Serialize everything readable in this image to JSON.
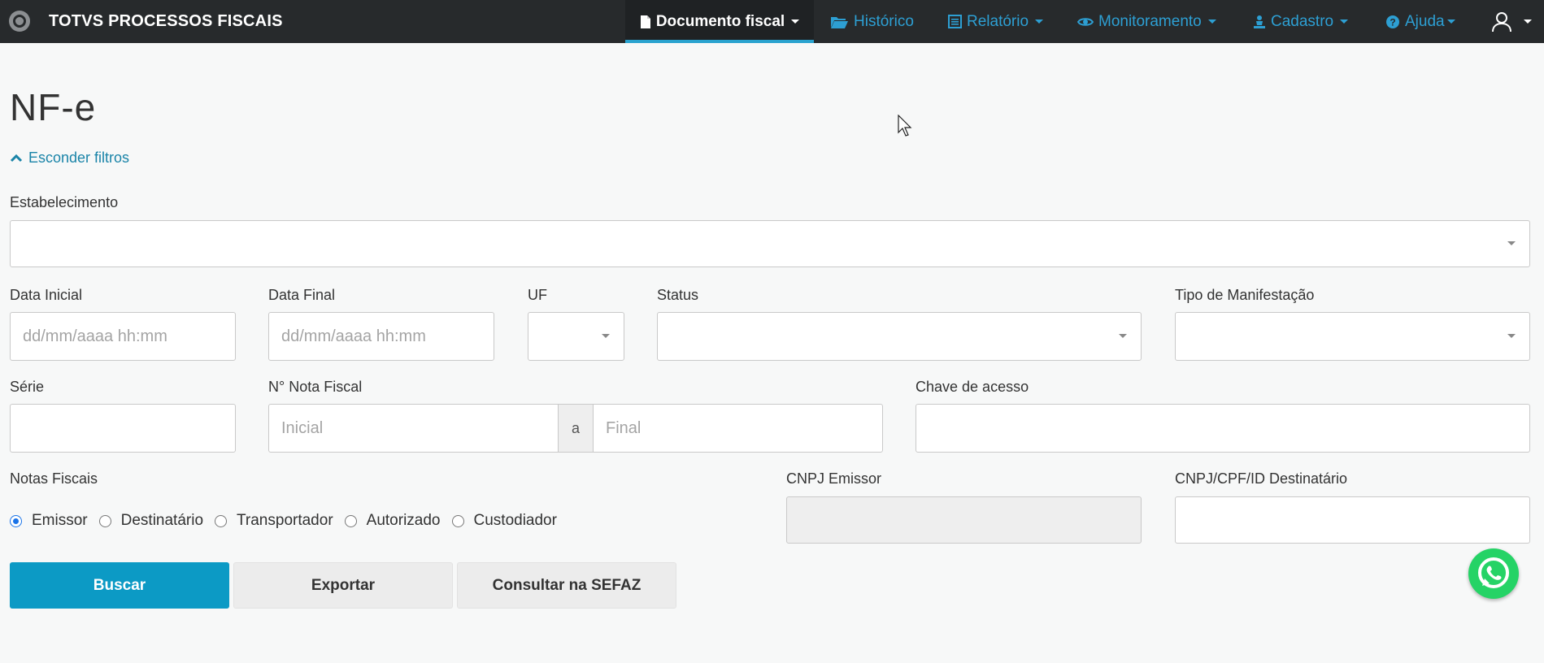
{
  "app": {
    "name": "TOTVS PROCESSOS FISCAIS"
  },
  "nav": {
    "documento": "Documento fiscal",
    "historico": "Histórico",
    "relatorio": "Relatório",
    "monitoramento": "Monitoramento",
    "cadastro": "Cadastro",
    "ajuda": "Ajuda"
  },
  "page": {
    "title": "NF-e",
    "toggle_filters": "Esconder filtros"
  },
  "filters": {
    "estabelecimento": {
      "label": "Estabelecimento",
      "value": ""
    },
    "data_inicial": {
      "label": "Data Inicial",
      "placeholder": "dd/mm/aaaa hh:mm"
    },
    "data_final": {
      "label": "Data Final",
      "placeholder": "dd/mm/aaaa hh:mm"
    },
    "uf": {
      "label": "UF",
      "value": ""
    },
    "status": {
      "label": "Status",
      "value": ""
    },
    "tipo_manifestacao": {
      "label": "Tipo de Manifestação",
      "value": ""
    },
    "serie": {
      "label": "Série",
      "value": ""
    },
    "nota_fiscal": {
      "label": "N° Nota Fiscal",
      "initial_placeholder": "Inicial",
      "separator": "a",
      "final_placeholder": "Final"
    },
    "chave_acesso": {
      "label": "Chave de acesso",
      "value": ""
    },
    "notas_fiscais": {
      "label": "Notas Fiscais",
      "options": [
        "Emissor",
        "Destinatário",
        "Transportador",
        "Autorizado",
        "Custodiador"
      ],
      "selected": "Emissor"
    },
    "cnpj_emissor": {
      "label": "CNPJ Emissor",
      "value": ""
    },
    "cnpj_destinatario": {
      "label": "CNPJ/CPF/ID Destinatário",
      "value": ""
    }
  },
  "actions": {
    "buscar": "Buscar",
    "exportar": "Exportar",
    "consultar": "Consultar na SEFAZ"
  },
  "colors": {
    "navbar_bg": "#272a2c",
    "nav_link": "#2d9fd3",
    "accent": "#0c9ac5",
    "link": "#1a84a8",
    "whatsapp": "#25d366"
  },
  "icons": {
    "brand": "totvs-logo-icon",
    "documento": "file-icon",
    "historico": "folder-open-icon",
    "relatorio": "list-alt-icon",
    "monitoramento": "eye-icon",
    "cadastro": "pawn-icon",
    "ajuda": "question-circle-icon",
    "user": "user-icon",
    "toggle": "chevron-up-icon",
    "chat": "whatsapp-icon"
  }
}
